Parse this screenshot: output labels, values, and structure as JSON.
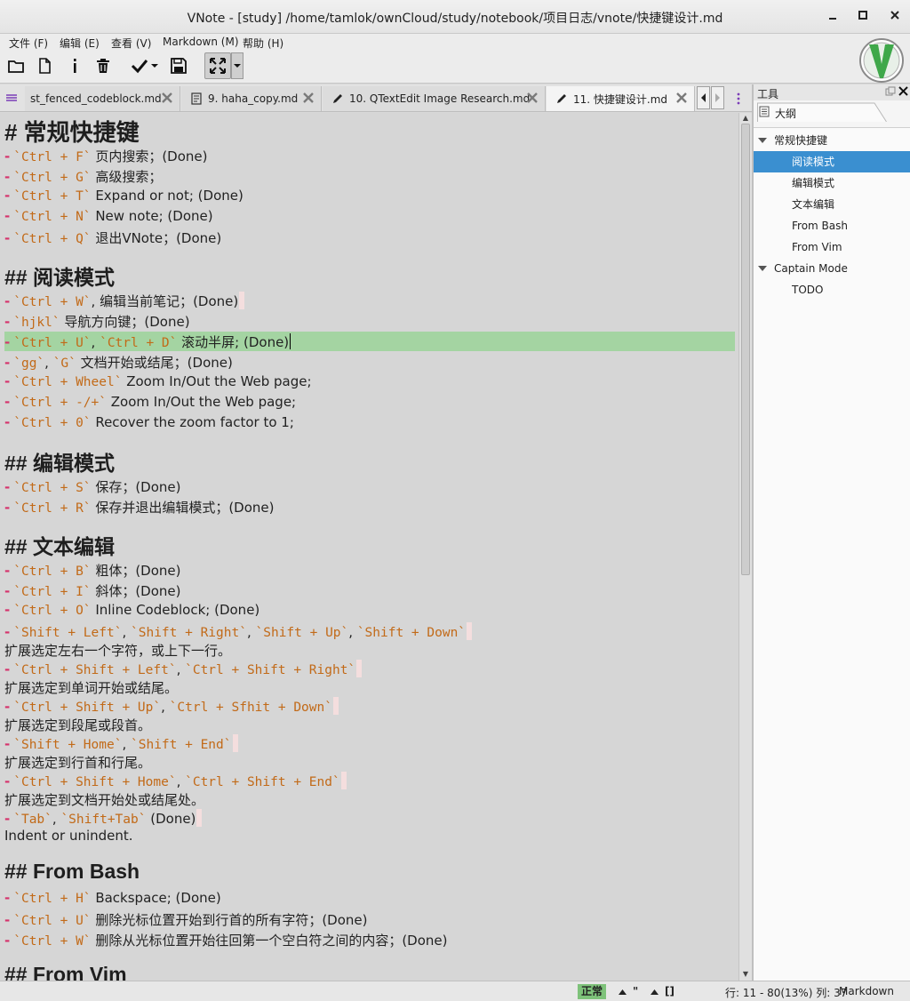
{
  "window": {
    "title": "VNote - [study] /home/tamlok/ownCloud/study/notebook/项目日志/vnote/快捷键设计.md",
    "minimize": "–",
    "maximize": "□",
    "close": "✕"
  },
  "menus": [
    "文件 (F)",
    "编辑 (E)",
    "查看 (V)",
    "Markdown (M)",
    "帮助 (H)"
  ],
  "toolbar": {
    "icons": [
      "open-folder-icon",
      "new-file-icon",
      "info-icon",
      "trash-icon",
      "check-icon",
      "dropdown-icon",
      "save-icon",
      "expand-icon",
      "dropdown-icon"
    ]
  },
  "tabs": [
    {
      "label": "st_fenced_codeblock.md"
    },
    {
      "label": "9. haha_copy.md"
    },
    {
      "label": "10. QTextEdit Image Research.md"
    },
    {
      "label": "11. 快捷键设计.md"
    }
  ],
  "editor": {
    "lines": [
      {
        "kind": "h1",
        "text": "# 常规快捷键"
      },
      {
        "kind": "li",
        "code": "`Ctrl + F`",
        "text": " 页内搜索；(Done)"
      },
      {
        "kind": "li",
        "code": "`Ctrl + G`",
        "text": " 高级搜索；"
      },
      {
        "kind": "li",
        "code": "`Ctrl + T`",
        "text": " Expand or not; (Done)"
      },
      {
        "kind": "li",
        "code": "`Ctrl + N`",
        "text": " New note; (Done)"
      },
      {
        "kind": "li",
        "code": "`Ctrl + Q`",
        "text": " 退出VNote；(Done)"
      },
      {
        "kind": "h2",
        "text": "## 阅读模式"
      },
      {
        "kind": "li",
        "code": "`Ctrl + W`",
        "text": ", 编辑当前笔记；(Done)"
      },
      {
        "kind": "li",
        "code": "`hjkl`",
        "text": " 导航方向键；(Done)"
      },
      {
        "kind": "li",
        "code": "`Ctrl + U`",
        "sep": ", ",
        "code2": "`Ctrl + D`",
        "text": " 滚动半屏; (Done)"
      },
      {
        "kind": "li",
        "code": "`gg`",
        "sep": ", ",
        "code2": "`G`",
        "text": " 文档开始或结尾；(Done)"
      },
      {
        "kind": "li",
        "code": "`Ctrl + Wheel`",
        "text": " Zoom In/Out the Web page;"
      },
      {
        "kind": "li",
        "code": "`Ctrl + -/+`",
        "text": " Zoom In/Out the Web page;"
      },
      {
        "kind": "li",
        "code": "`Ctrl + 0`",
        "text": " Recover the zoom factor to 1;"
      },
      {
        "kind": "h2",
        "text": "## 编辑模式"
      },
      {
        "kind": "li",
        "code": "`Ctrl + S`",
        "text": " 保存；(Done)"
      },
      {
        "kind": "li",
        "code": "`Ctrl + R`",
        "text": " 保存并退出编辑模式；(Done)"
      },
      {
        "kind": "h2",
        "text": "## 文本编辑"
      },
      {
        "kind": "li",
        "code": "`Ctrl + B`",
        "text": " 粗体；(Done)"
      },
      {
        "kind": "li",
        "code": "`Ctrl + I`",
        "text": " 斜体；(Done)"
      },
      {
        "kind": "li",
        "code": "`Ctrl + O`",
        "text": " Inline Codeblock; (Done)"
      },
      {
        "kind": "li",
        "code": "`Shift + Left`",
        "sep": ", ",
        "code2": "`Shift + Right`",
        "sep2": ", ",
        "code3": "`Shift + Up`",
        "sep3": ", ",
        "code4": "`Shift + Down`",
        "text": ""
      },
      {
        "kind": "p",
        "text": "扩展选定左右一个字符，或上下一行。"
      },
      {
        "kind": "li",
        "code": "`Ctrl + Shift + Left`",
        "sep": ", ",
        "code2": "`Ctrl + Shift + Right`",
        "text": ""
      },
      {
        "kind": "p",
        "text": "扩展选定到单词开始或结尾。"
      },
      {
        "kind": "li",
        "code": "`Ctrl + Shift + Up`",
        "sep": ", ",
        "code2": "`Ctrl + Sfhit + Down`",
        "text": ""
      },
      {
        "kind": "p",
        "text": "扩展选定到段尾或段首。"
      },
      {
        "kind": "li",
        "code": "`Shift + Home`",
        "sep": ", ",
        "code2": "`Shift + End`",
        "text": ""
      },
      {
        "kind": "p",
        "text": "扩展选定到行首和行尾。"
      },
      {
        "kind": "li",
        "code": "`Ctrl + Shift + Home`",
        "sep": ", ",
        "code2": "`Ctrl + Shift + End`",
        "text": ""
      },
      {
        "kind": "p",
        "text": "扩展选定到文档开始处或结尾处。"
      },
      {
        "kind": "li",
        "code": "`Tab`",
        "sep": ", ",
        "code2": "`Shift+Tab`",
        "text": " (Done)"
      },
      {
        "kind": "p",
        "text": "Indent or unindent."
      },
      {
        "kind": "h2",
        "text": "## From Bash"
      },
      {
        "kind": "li",
        "code": "`Ctrl + H`",
        "text": " Backspace; (Done)"
      },
      {
        "kind": "li",
        "code": "`Ctrl + U`",
        "text": " 删除光标位置开始到行首的所有字符；(Done)"
      },
      {
        "kind": "li",
        "code": "`Ctrl + W`",
        "text": " 删除从光标位置开始往回第一个空白符之间的内容；(Done)"
      },
      {
        "kind": "h2",
        "text": "## From Vim"
      }
    ]
  },
  "panel": {
    "title": "工具",
    "tab": "大纲",
    "outline": [
      {
        "label": "常规快捷键",
        "level": 0,
        "expanded": true
      },
      {
        "label": "阅读模式",
        "level": 1,
        "selected": true
      },
      {
        "label": "编辑模式",
        "level": 1
      },
      {
        "label": "文本编辑",
        "level": 1
      },
      {
        "label": "From Bash",
        "level": 1
      },
      {
        "label": "From Vim",
        "level": 1
      },
      {
        "label": "Captain Mode",
        "level": 0,
        "expanded": true
      },
      {
        "label": "TODO",
        "level": 1
      }
    ]
  },
  "status": {
    "mode": "正常",
    "marks1": "\"",
    "marks2": "[]",
    "position": "行: 11 - 80(13%) 列: 37",
    "type": "Markdown"
  },
  "colors": {
    "accent": "#3a8fd0",
    "cursor_line": "#a4d4a2",
    "code": "#c26a18",
    "dash": "#d6336c"
  }
}
